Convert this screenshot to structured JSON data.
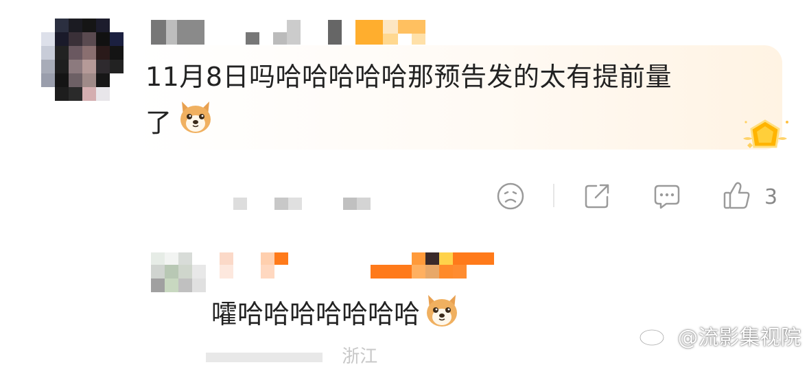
{
  "comment": {
    "text_line1": "11月8日吗哈哈哈哈哈那预告发的太有提前量",
    "text_line2": "了",
    "emoji": "dog-face-emoji"
  },
  "actions": {
    "like_count": "3"
  },
  "reply": {
    "text": "嚯哈哈哈哈哈哈哈",
    "emoji": "dog-face-emoji"
  },
  "watermark": {
    "text": "@流影集视院"
  },
  "bottom_partial": {
    "text": "浙江"
  },
  "colors": {
    "accent_orange": "#ff8c00",
    "badge_gold": "#ffb400",
    "icon_gray": "#9a9a9a"
  }
}
